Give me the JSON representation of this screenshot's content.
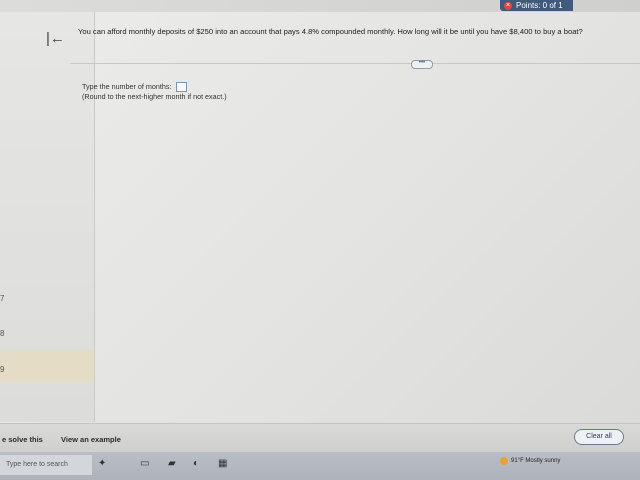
{
  "header": {
    "points_label": "Points: 0 of 1"
  },
  "sidebar": {
    "numbers": [
      "7",
      "8",
      "9"
    ]
  },
  "question": {
    "text": "You can afford monthly deposits of $250 into an account that pays 4.8% compounded monthly. How long will it be until you have $8,400 to buy a boat?"
  },
  "answer": {
    "prompt": "Type the number of months:",
    "hint": "(Round to the next-higher month if not exact.)",
    "value": ""
  },
  "bottom": {
    "help_solve": "e solve this",
    "view_example": "View an example",
    "clear_all": "Clear all"
  },
  "taskbar": {
    "search_placeholder": "Type here to search",
    "weather": "91°F Mostly sunny"
  },
  "colors": {
    "points_bg": "#3f5a7a",
    "points_icon": "#d84b3f",
    "input_border": "#7d95b4"
  }
}
